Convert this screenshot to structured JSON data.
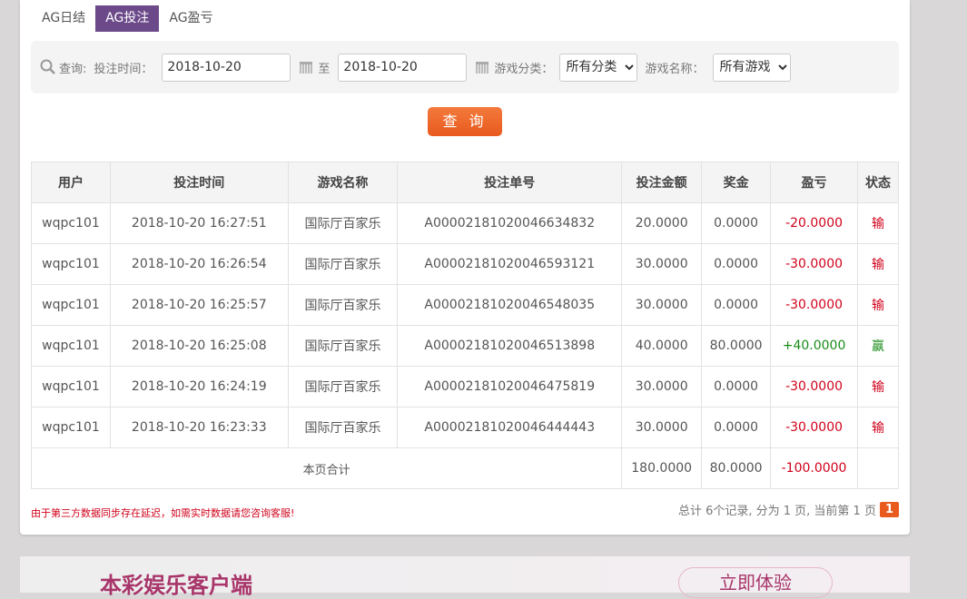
{
  "tabs": [
    {
      "label": "AG日结"
    },
    {
      "label": "AG投注"
    },
    {
      "label": "AG盈亏"
    }
  ],
  "filter": {
    "query_label": "查询:",
    "time_label": "投注时间：",
    "start_date": "2018-10-20",
    "to_label": "至",
    "end_date": "2018-10-20",
    "category_label": "游戏分类：",
    "category_value": "所有分类",
    "game_label": "游戏名称：",
    "game_value": "所有游戏"
  },
  "search_button": "查 询",
  "table": {
    "headers": [
      "用户",
      "投注时间",
      "游戏名称",
      "投注单号",
      "投注金额",
      "奖金",
      "盈亏",
      "状态"
    ],
    "rows": [
      [
        "wqpc101",
        "2018-10-20 16:27:51",
        "国际厅百家乐",
        "A00002181020046634832",
        "20.0000",
        "0.0000",
        "-20.0000",
        "输"
      ],
      [
        "wqpc101",
        "2018-10-20 16:26:54",
        "国际厅百家乐",
        "A00002181020046593121",
        "30.0000",
        "0.0000",
        "-30.0000",
        "输"
      ],
      [
        "wqpc101",
        "2018-10-20 16:25:57",
        "国际厅百家乐",
        "A00002181020046548035",
        "30.0000",
        "0.0000",
        "-30.0000",
        "输"
      ],
      [
        "wqpc101",
        "2018-10-20 16:25:08",
        "国际厅百家乐",
        "A00002181020046513898",
        "40.0000",
        "80.0000",
        "+40.0000",
        "赢"
      ],
      [
        "wqpc101",
        "2018-10-20 16:24:19",
        "国际厅百家乐",
        "A00002181020046475819",
        "30.0000",
        "0.0000",
        "-30.0000",
        "输"
      ],
      [
        "wqpc101",
        "2018-10-20 16:23:33",
        "国际厅百家乐",
        "A00002181020046444443",
        "30.0000",
        "0.0000",
        "-30.0000",
        "输"
      ]
    ],
    "total": {
      "label": "本页合计",
      "amount": "180.0000",
      "bonus": "80.0000",
      "profit": "-100.0000"
    }
  },
  "note": "由于第三方数据同步存在延迟，如需实时数据请您咨询客服!",
  "pager": {
    "text": "总计 6个记录, 分为 1 页, 当前第 1 页",
    "current": "1"
  },
  "banner": {
    "title": "本彩娱乐客户端",
    "button": "立即体验"
  },
  "colors": {
    "accent": "#6c4a8a",
    "button": "#e85a1e",
    "loss": "#d0021b",
    "win": "#1a8c1a"
  }
}
